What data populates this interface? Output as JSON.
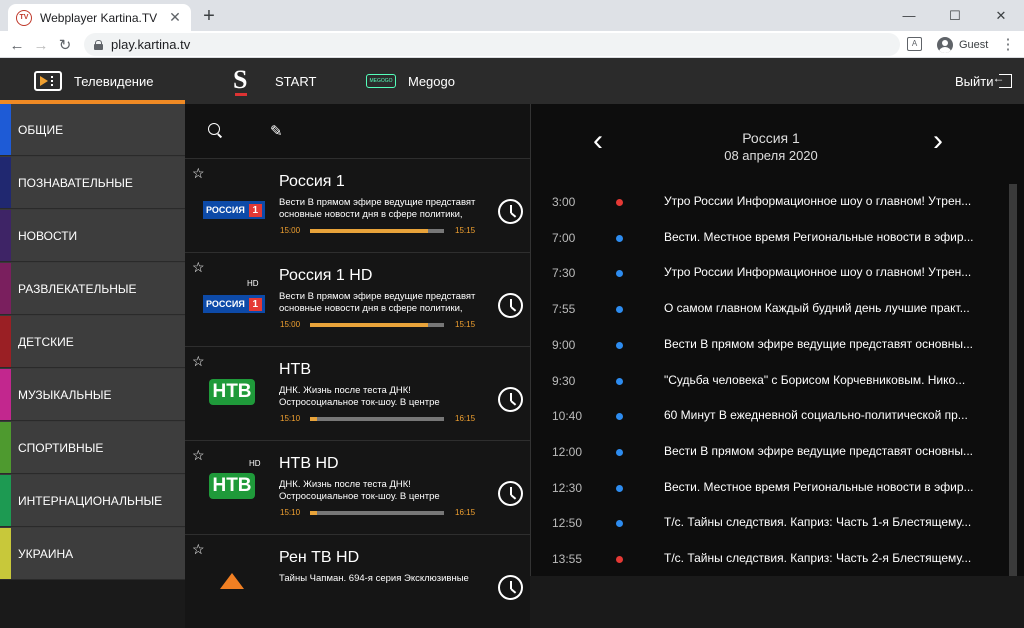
{
  "browser": {
    "tab_title": "Webplayer Kartina.TV",
    "tab_favicon": "TV",
    "url": "play.kartina.tv",
    "profile": "Guest",
    "newtab_glyph": "+",
    "close_glyph": "✕",
    "min_glyph": "—",
    "max_glyph": "☐",
    "winclose_glyph": "✕"
  },
  "app_header": {
    "tv_label": "Телевидение",
    "start_label": "START",
    "megogo_label": "Megogo",
    "megogo_logo": "MEGOGO",
    "exit_label": "Выйти"
  },
  "categories": [
    {
      "label": "ОБЩИЕ",
      "color": "#1e5bd6"
    },
    {
      "label": "ПОЗНАВАТЕЛЬНЫЕ",
      "color": "#202870"
    },
    {
      "label": "НОВОСТИ",
      "color": "#3e2466"
    },
    {
      "label": "РАЗВЛЕКАТЕЛЬНЫЕ",
      "color": "#7a1f5e"
    },
    {
      "label": "ДЕТСКИЕ",
      "color": "#9a1f24"
    },
    {
      "label": "МУЗЫКАЛЬНЫЕ",
      "color": "#c2278e"
    },
    {
      "label": "СПОРТИВНЫЕ",
      "color": "#4e9a2f"
    },
    {
      "label": "ИНТЕРНАЦИОНАЛЬНЫЕ",
      "color": "#1d9a52"
    },
    {
      "label": "УКРАИНА",
      "color": "#c8c83a"
    }
  ],
  "channels": [
    {
      "name": "Россия 1",
      "logo": "РОССИЯ",
      "logo_num": "1",
      "hd": "",
      "desc": "Вести В прямом эфире ведущие представят основные новости дня в сфере политики,",
      "start": "15:00",
      "end": "15:15",
      "progress": 0.88
    },
    {
      "name": "Россия 1 HD",
      "logo": "РОССИЯ",
      "logo_num": "1",
      "hd": "HD",
      "desc": "Вести В прямом эфире ведущие представят основные новости дня в сфере политики,",
      "start": "15:00",
      "end": "15:15",
      "progress": 0.88
    },
    {
      "name": "НТВ",
      "logo": "НТВ",
      "hd": "",
      "desc": "ДНК. Жизнь после теста ДНК! Остросоциальное ток-шоу. В центре",
      "start": "15:10",
      "end": "16:15",
      "progress": 0.05
    },
    {
      "name": "НТВ HD",
      "logo": "НТВ",
      "hd": "HD",
      "desc": "ДНК. Жизнь после теста ДНК! Остросоциальное ток-шоу. В центре",
      "start": "15:10",
      "end": "16:15",
      "progress": 0.05
    },
    {
      "name": "Рен ТВ HD",
      "desc": "Тайны Чапман. 694-я серия Эксклюзивные"
    }
  ],
  "epg": {
    "channel": "Россия 1",
    "date": "08 апреля 2020",
    "prev_glyph": "‹",
    "next_glyph": "›",
    "items": [
      {
        "time": "3:00",
        "title": "Утро России Информационное шоу о главном! Утрен...",
        "dot": "#e53935"
      },
      {
        "time": "7:00",
        "title": "Вести. Местное время Региональные новости в эфир...",
        "dot": "#2d8cf0"
      },
      {
        "time": "7:30",
        "title": "Утро России Информационное шоу о главном! Утрен...",
        "dot": "#2d8cf0"
      },
      {
        "time": "7:55",
        "title": "О самом главном Каждый будний день лучшие практ...",
        "dot": "#2d8cf0"
      },
      {
        "time": "9:00",
        "title": "Вести В прямом эфире ведущие представят основны...",
        "dot": "#2d8cf0"
      },
      {
        "time": "9:30",
        "title": "\"Судьба человека\" с Борисом Корчевниковым. Нико...",
        "dot": "#2d8cf0"
      },
      {
        "time": "10:40",
        "title": "60 Минут В ежедневной социально-политической пр...",
        "dot": "#2d8cf0"
      },
      {
        "time": "12:00",
        "title": "Вести В прямом эфире ведущие представят основны...",
        "dot": "#2d8cf0"
      },
      {
        "time": "12:30",
        "title": "Вести. Местное время Региональные новости в эфир...",
        "dot": "#2d8cf0"
      },
      {
        "time": "12:50",
        "title": "Т/с. Тайны следствия. Каприз: Часть 1-я Блестящему...",
        "dot": "#2d8cf0"
      },
      {
        "time": "13:55",
        "title": "Т/с. Тайны следствия. Каприз: Часть 2-я Блестящему...",
        "dot": "#e53935"
      }
    ]
  }
}
